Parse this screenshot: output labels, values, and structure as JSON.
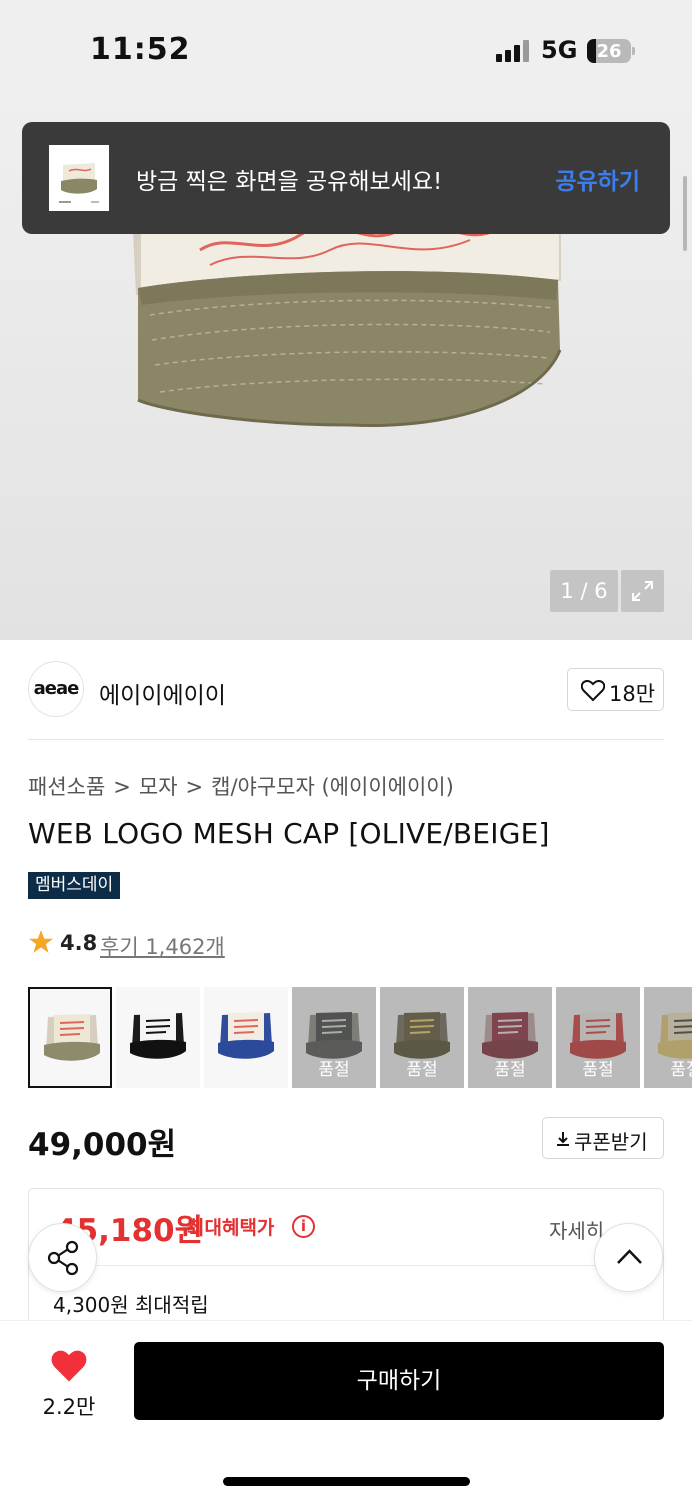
{
  "status_bar": {
    "time": "11:52",
    "network": "5G",
    "battery": "26"
  },
  "toast": {
    "message": "방금 찍은 화면을 공유해보세요!",
    "action": "공유하기"
  },
  "gallery": {
    "counter": "1 / 6",
    "current": 1,
    "total": 6
  },
  "brand": {
    "logo_text": "aeae",
    "name": "에이이에이이",
    "likes": "18만"
  },
  "breadcrumbs": [
    "패션소품",
    "모자",
    "캡/야구모자 (에이이에이이)"
  ],
  "product": {
    "title": "WEB LOGO MESH CAP [OLIVE/BEIGE]",
    "badge": "멤버스데이",
    "rating": "4.8",
    "reviews": "후기 1,462개",
    "price": "49,000원",
    "coupon_label": "쿠폰받기"
  },
  "swatches": [
    {
      "colors": {
        "crown": "#ede7d6",
        "mesh": "#d6cfbf",
        "brim": "#8e8a6c",
        "text": "#e0655c"
      },
      "sold_out": false,
      "selected": true
    },
    {
      "colors": {
        "crown": "#f5f5f5",
        "mesh": "#1a1a1a",
        "brim": "#111111",
        "text": "#111111"
      },
      "sold_out": false,
      "selected": false
    },
    {
      "colors": {
        "crown": "#f2ede2",
        "mesh": "#2f4d9c",
        "brim": "#2b4a9a",
        "text": "#e0655c"
      },
      "sold_out": false,
      "selected": false
    },
    {
      "colors": {
        "crown": "#3a3d38",
        "mesh": "#8a8a82",
        "brim": "#4b4d47",
        "text": "#dddddd"
      },
      "sold_out": true,
      "sold_label": "품절",
      "selected": false
    },
    {
      "colors": {
        "crown": "#5b4f2a",
        "mesh": "#6b6650",
        "brim": "#4d4526",
        "text": "#f0d060"
      },
      "sold_out": true,
      "sold_label": "품절",
      "selected": false
    },
    {
      "colors": {
        "crown": "#8c2333",
        "mesh": "#c4a3a5",
        "brim": "#7a1f2c",
        "text": "#f2e4e4"
      },
      "sold_out": true,
      "sold_label": "품절",
      "selected": false
    },
    {
      "colors": {
        "crown": "#f3f0ea",
        "mesh": "#d63232",
        "brim": "#c92b2b",
        "text": "#d63232"
      },
      "sold_out": true,
      "sold_label": "품절",
      "selected": false
    },
    {
      "colors": {
        "crown": "#f2e7c2",
        "mesh": "#e8c66b",
        "brim": "#e8c66b",
        "text": "#333333"
      },
      "sold_out": true,
      "sold_label": "품절",
      "selected": false
    }
  ],
  "benefit": {
    "sale_price": "45,180원",
    "max_benefit_label": "최대혜택가",
    "info_icon": "i",
    "detail_label": "자세히",
    "points": "4,300원 최대적립"
  },
  "bottom": {
    "wish_count": "2.2만",
    "buy_label": "구매하기"
  },
  "colors": {
    "accent_blue": "#3a7ef0",
    "sale_red": "#e33030",
    "badge_navy": "#0c2c48",
    "heart_red": "#f2303a"
  }
}
